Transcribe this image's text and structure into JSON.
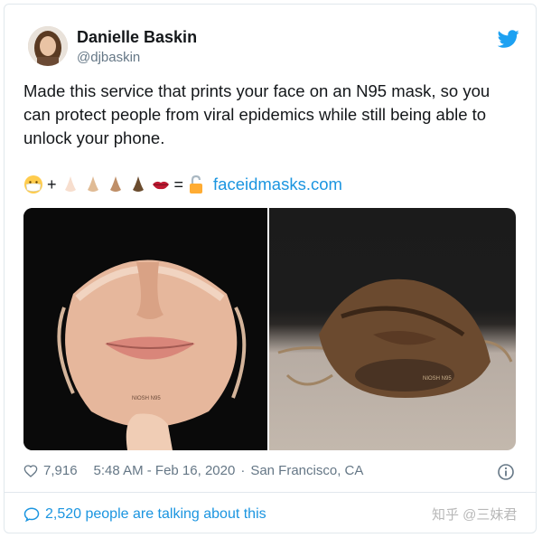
{
  "author": {
    "name": "Danielle Baskin",
    "handle": "@djbaskin"
  },
  "tweet": {
    "text_line1": "Made this service that prints your face on an N95 mask, so you",
    "text_line2": "can protect people from viral epidemics while still being able to",
    "text_line3": "unlock your phone.",
    "emoji_plus": "+",
    "emoji_equals": "=",
    "link": "faceidmasks.com"
  },
  "media": {
    "left_mask_label": "NIOSH N95",
    "right_mask_label": "NIOSH N95"
  },
  "meta": {
    "likes": "7,916",
    "timestamp": "5:48 AM - Feb 16, 2020",
    "separator": "·",
    "location": "San Francisco, CA"
  },
  "footer": {
    "talking": "2,520 people are talking about this",
    "watermark": "知乎 @三妹君"
  },
  "colors": {
    "link": "#1b95e0",
    "muted": "#657786",
    "text": "#14171a"
  },
  "icons": [
    "twitter-bird-icon",
    "heart-icon",
    "info-icon",
    "speech-bubble-icon"
  ]
}
